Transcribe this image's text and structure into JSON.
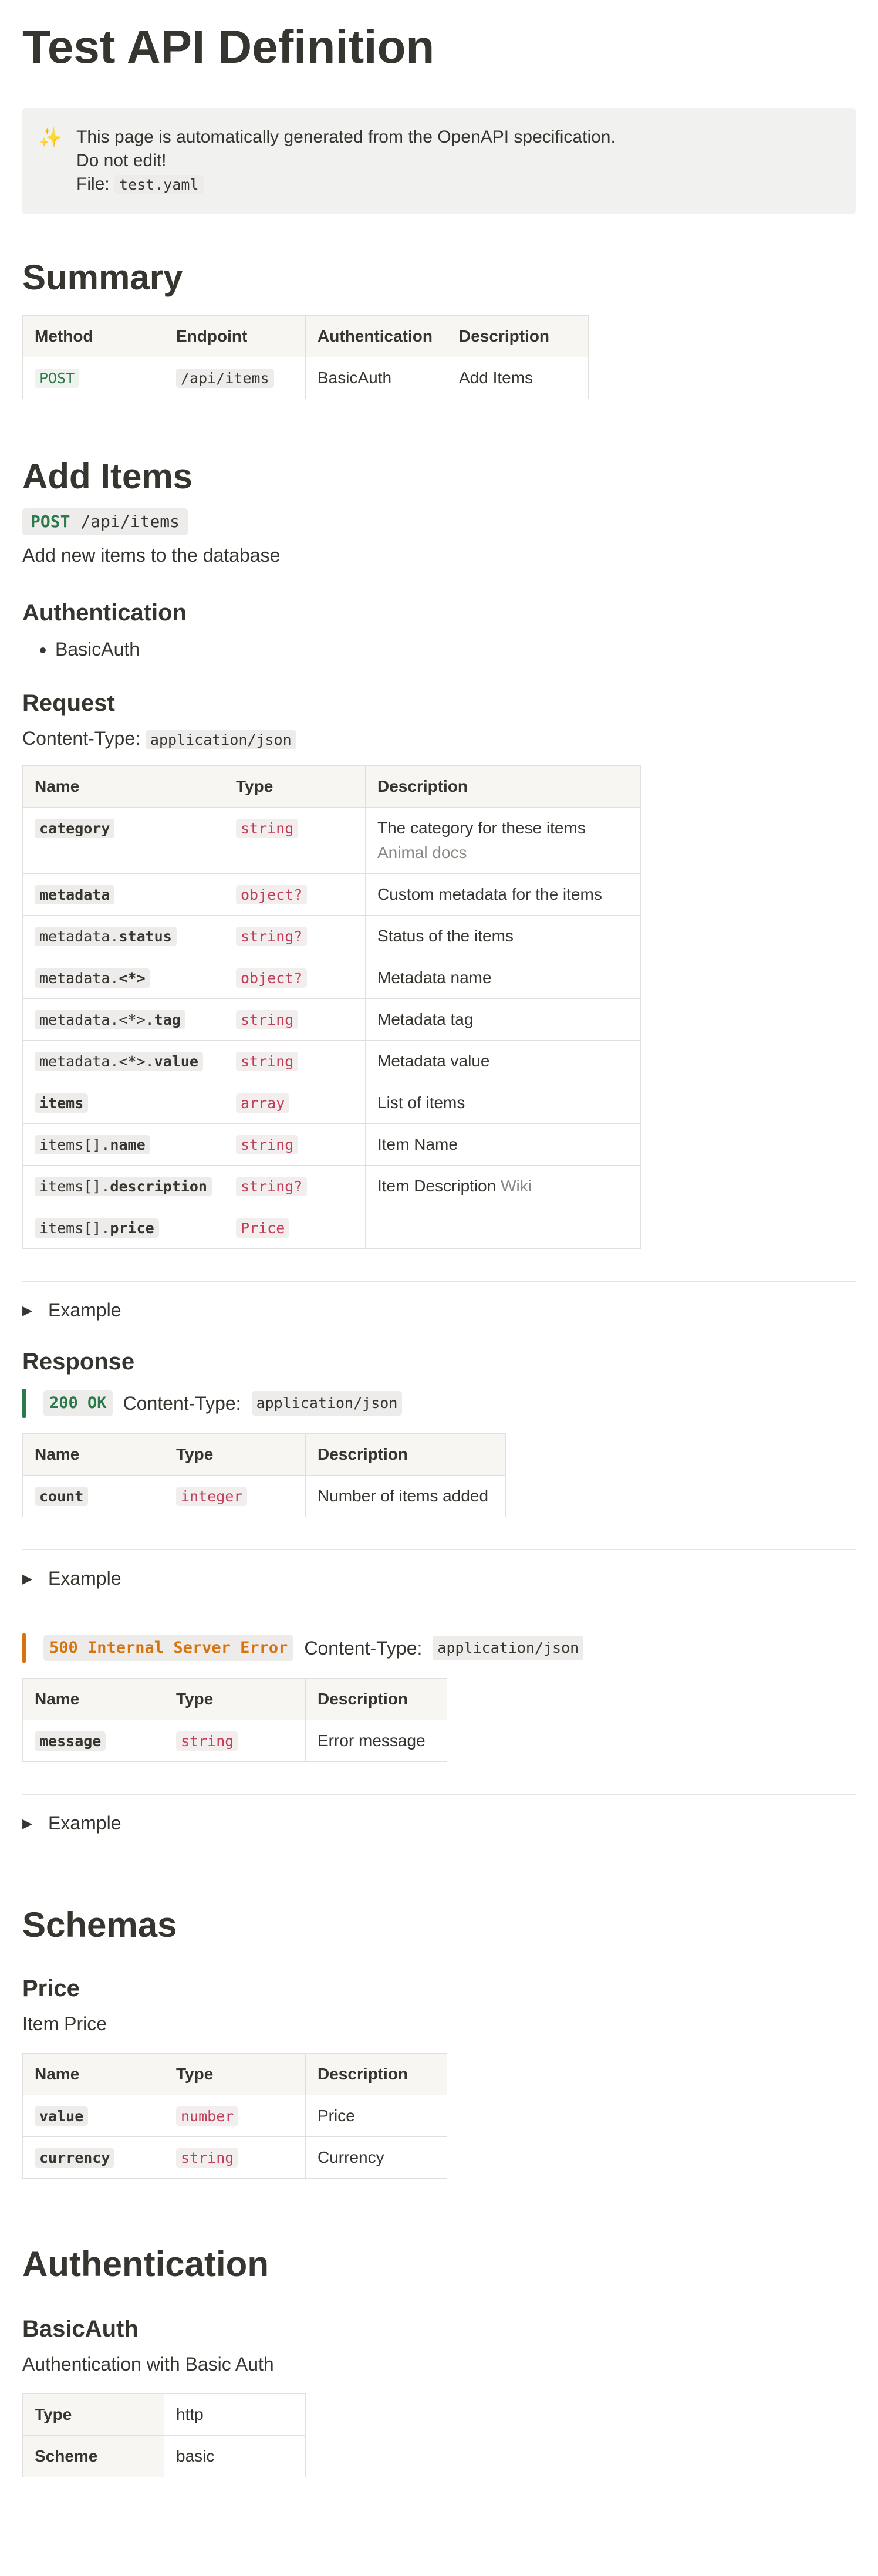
{
  "page": {
    "title": "Test API Definition"
  },
  "callout": {
    "emoji": "✨",
    "line1": "This page is automatically generated from the OpenAPI specification.",
    "line2": "Do not edit!",
    "file_label": "File:",
    "file_name": "test.yaml"
  },
  "summary": {
    "heading": "Summary",
    "columns": [
      "Method",
      "Endpoint",
      "Authentication",
      "Description"
    ],
    "rows": [
      {
        "method": "POST",
        "endpoint": "/api/items",
        "auth": "BasicAuth",
        "description": "Add Items"
      }
    ]
  },
  "add_items": {
    "heading": "Add Items",
    "method": "POST",
    "path": "/api/items",
    "description": "Add new items to the database",
    "auth_heading": "Authentication",
    "auth_items": [
      "BasicAuth"
    ],
    "request_heading": "Request",
    "content_type_label": "Content-Type:",
    "content_type": "application/json",
    "request_columns": [
      "Name",
      "Type",
      "Description"
    ],
    "request_rows": [
      {
        "name_prefix": "",
        "name": "category",
        "type": "string",
        "description": "The category for these items",
        "note": "Animal docs"
      },
      {
        "name_prefix": "",
        "name": "metadata",
        "type": "object?",
        "description": "Custom metadata for the items",
        "note": ""
      },
      {
        "name_prefix": "metadata.",
        "name": "status",
        "type": "string?",
        "description": "Status of the items",
        "note": ""
      },
      {
        "name_prefix": "metadata.",
        "name": "<*>",
        "type": "object?",
        "description": "Metadata name",
        "note": ""
      },
      {
        "name_prefix": "metadata.<*>.",
        "name": "tag",
        "type": "string",
        "description": "Metadata tag",
        "note": ""
      },
      {
        "name_prefix": "metadata.<*>.",
        "name": "value",
        "type": "string",
        "description": "Metadata value",
        "note": ""
      },
      {
        "name_prefix": "",
        "name": "items",
        "type": "array",
        "description": "List of items",
        "note": ""
      },
      {
        "name_prefix": "items[].",
        "name": "name",
        "type": "string",
        "description": "Item Name",
        "note": ""
      },
      {
        "name_prefix": "items[].",
        "name": "description",
        "type": "string?",
        "description": "Item Description",
        "note": "Wiki"
      },
      {
        "name_prefix": "items[].",
        "name": "price",
        "type": "Price",
        "description": "",
        "note": ""
      }
    ],
    "example_label": "Example",
    "response_heading": "Response",
    "responses": [
      {
        "status": "200 OK",
        "color": "#2c7a4b",
        "content_type_label": "Content-Type:",
        "content_type": "application/json",
        "columns": [
          "Name",
          "Type",
          "Description"
        ],
        "rows": [
          {
            "name": "count",
            "type": "integer",
            "description": "Number of items added"
          }
        ],
        "example_label": "Example"
      },
      {
        "status": "500 Internal Server Error",
        "color": "#d9730d",
        "content_type_label": "Content-Type:",
        "content_type": "application/json",
        "columns": [
          "Name",
          "Type",
          "Description"
        ],
        "rows": [
          {
            "name": "message",
            "type": "string",
            "description": "Error message"
          }
        ],
        "example_label": "Example"
      }
    ]
  },
  "schemas": {
    "heading": "Schemas",
    "price": {
      "heading": "Price",
      "description": "Item Price",
      "columns": [
        "Name",
        "Type",
        "Description"
      ],
      "rows": [
        {
          "name": "value",
          "type": "number",
          "description": "Price"
        },
        {
          "name": "currency",
          "type": "string",
          "description": "Currency"
        }
      ]
    }
  },
  "authentication": {
    "heading": "Authentication",
    "basic_auth": {
      "heading": "BasicAuth",
      "description": "Authentication with Basic Auth",
      "rows": [
        {
          "key": "Type",
          "value": "http"
        },
        {
          "key": "Scheme",
          "value": "basic"
        }
      ]
    }
  }
}
